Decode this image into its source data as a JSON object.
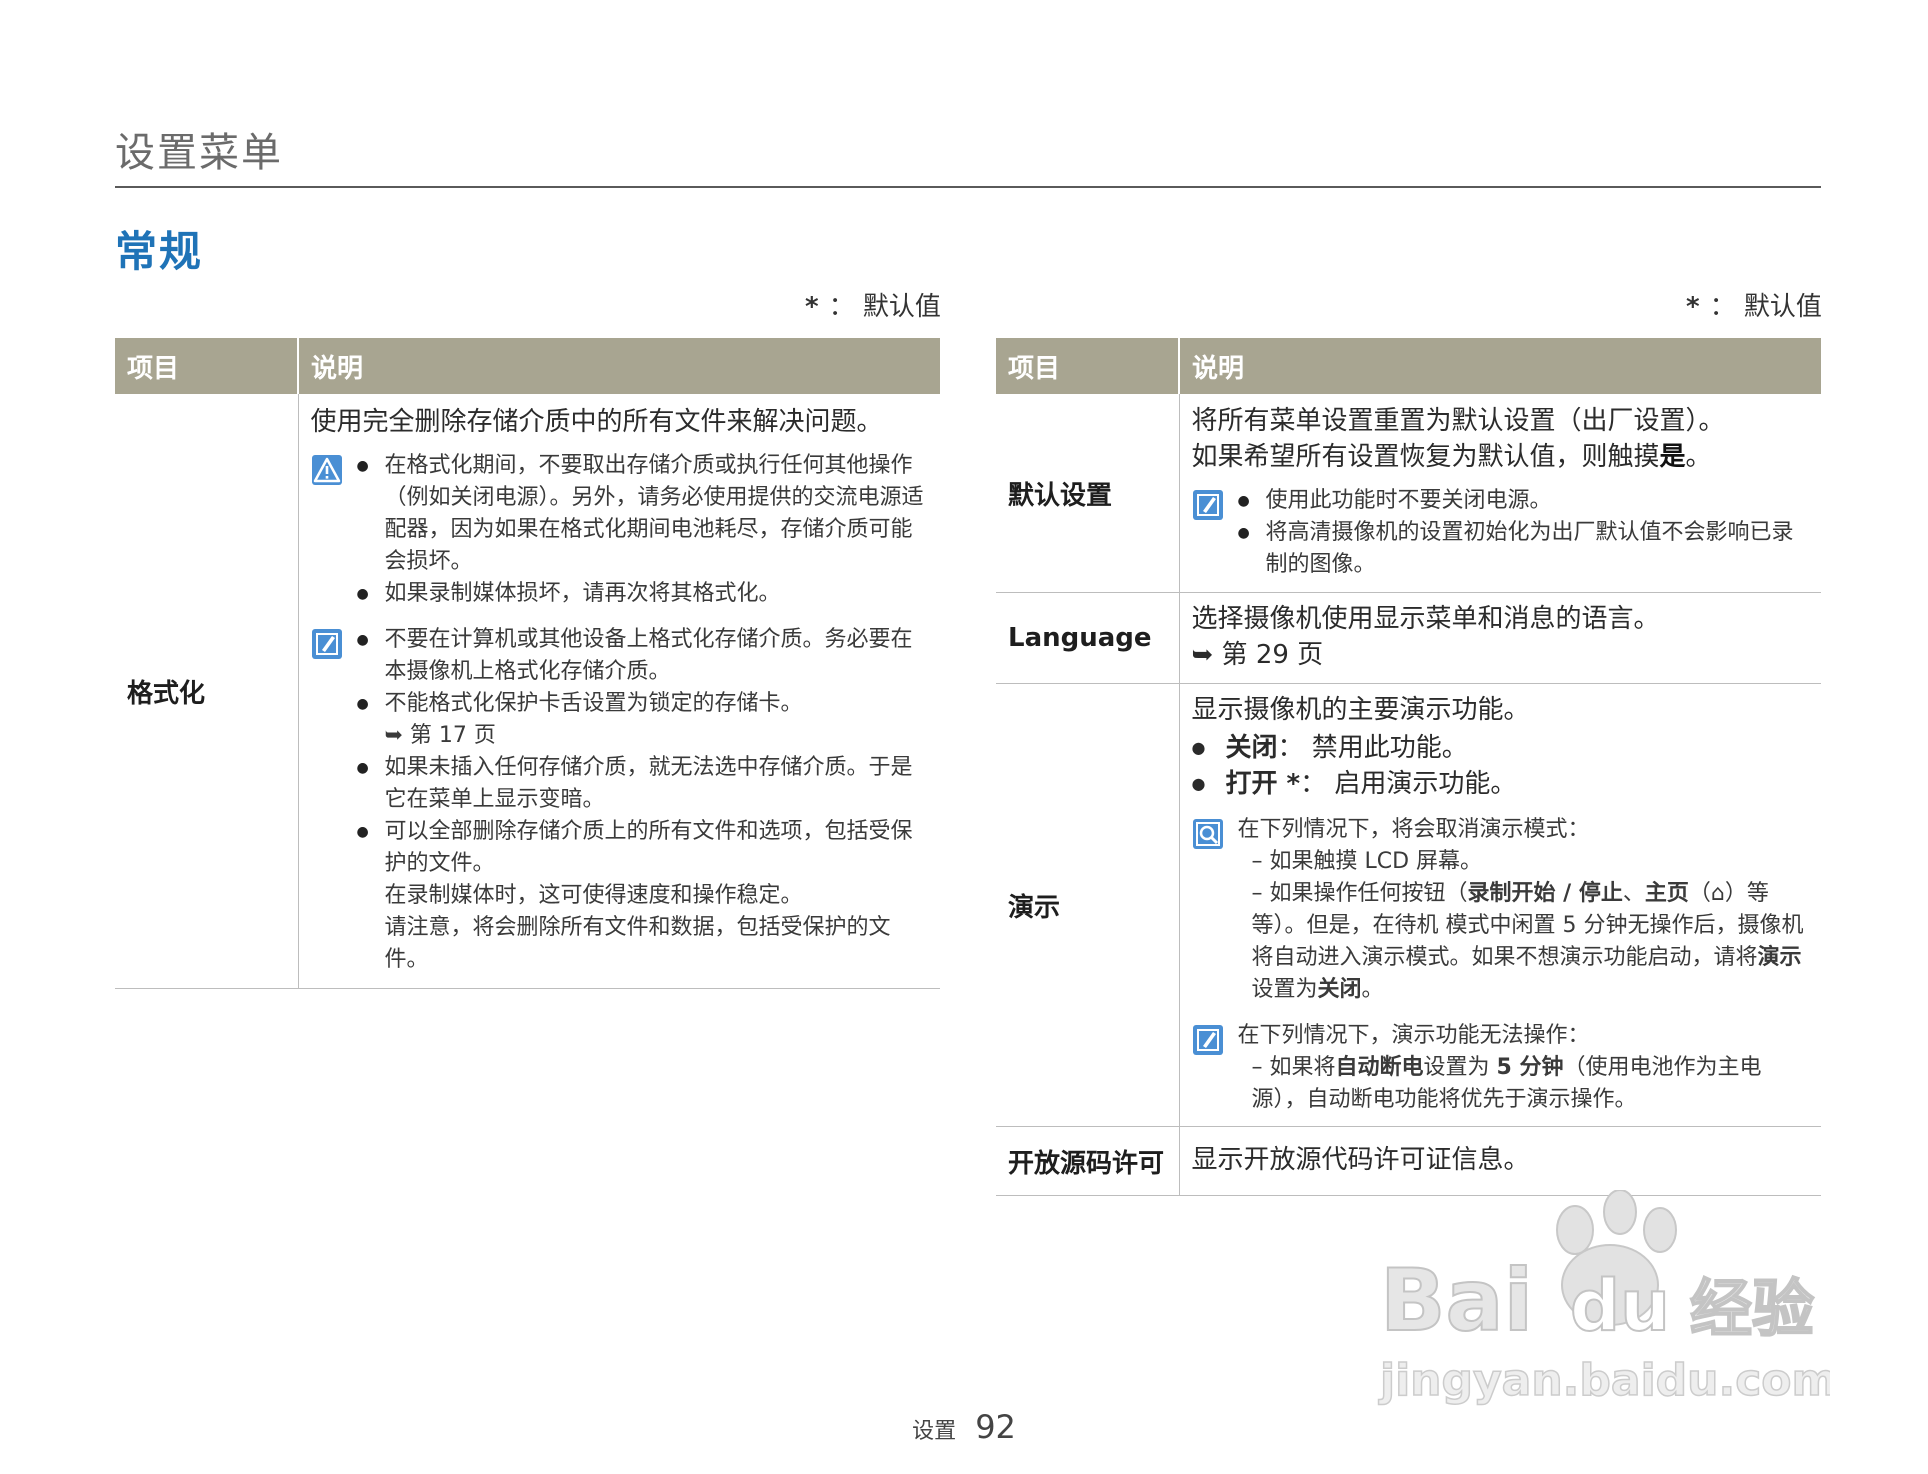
{
  "header": {
    "page_title": "设置菜单",
    "section_title": "常规",
    "default_note_star": "*",
    "default_note_text": "： 默认值"
  },
  "table_headers": {
    "item": "项目",
    "description": "说明"
  },
  "left_table": {
    "rows": [
      {
        "item": "格式化",
        "description": "使用完全删除存储介质中的所有文件来解决问题。",
        "warning_bullets": [
          "在格式化期间，不要取出存储介质或执行任何其他操作（例如关闭电源）。另外，请务必使用提供的交流电源适配器，因为如果在格式化期间电池耗尽，存储介质可能会损坏。",
          "如果录制媒体损坏，请再次将其格式化。"
        ],
        "note_bullets": [
          "不要在计算机或其他设备上格式化存储介质。务必要在本摄像机上格式化存储介质。",
          "不能格式化保护卡舌设置为锁定的存储卡。",
          "如果未插入任何存储介质，就无法选中存储介质。于是它在菜单上显示变暗。",
          "可以全部删除存储介质上的所有文件和选项，包括受保护的文件。"
        ],
        "note_ref": "➥ 第 17 页",
        "note_extra_1": "在录制媒体时，这可使得速度和操作稳定。",
        "note_extra_2": "请注意，将会删除所有文件和数据，包括受保护的文件。"
      }
    ]
  },
  "right_table": {
    "rows": [
      {
        "item": "默认设置",
        "desc_line_1": "将所有菜单设置重置为默认设置（出厂设置）。",
        "desc_line_2_pre": "如果希望所有设置恢复为默认值，则触摸",
        "desc_line_2_bold": "是",
        "desc_line_2_post": "。",
        "note_bullets": [
          "使用此功能时不要关闭电源。",
          "将高清摄像机的设置初始化为出厂默认值不会影响已录制的图像。"
        ]
      },
      {
        "item": "Language",
        "desc_line_1": "选择摄像机使用显示菜单和消息的语言。",
        "desc_ref": "➥ 第 29 页"
      },
      {
        "item": "演示",
        "desc_line_1": "显示摄像机的主要演示功能。",
        "opt_off_label": "关闭",
        "opt_off_text": "： 禁用此功能。",
        "opt_on_label": "打开 *",
        "opt_on_text": "： 启用演示功能。",
        "info_intro": "在下列情况下，将会取消演示模式：",
        "info_dash_1": "– 如果触摸 LCD 屏幕。",
        "info_dash_2_pre": "– 如果操作任何按钮（",
        "info_dash_2_bold": "录制开始 / 停止",
        "info_dash_2_sep": "、",
        "info_dash_2_bold2": "主页",
        "info_dash_2_home": "（⌂）",
        "info_dash_2_post": "等等）。但是，在待机 模式中闲置 5 分钟无操作后，摄像机将自动进入演示模式。如果不想演示功能启动，",
        "info_dash_2_tail_pre": "请将",
        "info_dash_2_tail_bold": "演示",
        "info_dash_2_tail_mid": "设置为",
        "info_dash_2_tail_bold2": "关闭",
        "info_dash_2_tail_post": "。",
        "note_intro": "在下列情况下，演示功能无法操作：",
        "note_dash_pre": "– 如果将",
        "note_dash_bold": "自动断电",
        "note_dash_mid": "设置为 ",
        "note_dash_bold2": "5 分钟",
        "note_dash_post": "（使用电池作为主电源），自动断电功能将优先于演示操作。"
      },
      {
        "item": "开放源码许可",
        "desc_line_1": "显示开放源代码许可证信息。"
      }
    ]
  },
  "footer": {
    "section": "设置",
    "page_number": "92"
  },
  "watermark": {
    "brand": "Bai",
    "brand2": "du",
    "suffix": "经验",
    "url": "jingyan.baidu.com"
  },
  "colors": {
    "header_bg": "#a8a591",
    "section_title": "#1f73b7",
    "icon_blue": "#4a8fd4"
  },
  "icons": [
    "warning-icon",
    "note-icon",
    "info-icon",
    "home-icon"
  ]
}
